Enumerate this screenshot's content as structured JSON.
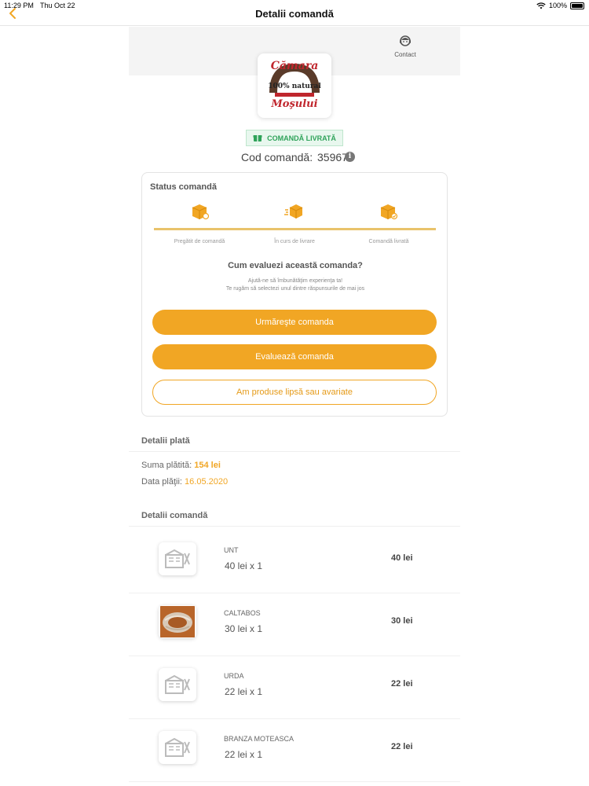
{
  "status_bar": {
    "time": "11:29 PM",
    "date": "Thu Oct 22",
    "battery": "100%"
  },
  "nav": {
    "title": "Detalii comandă"
  },
  "header": {
    "contact_label": "Contact",
    "logo_top": "Cămara",
    "logo_mid": "100% natural",
    "logo_bottom": "Moşului"
  },
  "order": {
    "badge": "COMANDĂ LIVRATĂ",
    "code_label": "Cod comandă:",
    "code": "35967",
    "info_glyph": "i"
  },
  "status": {
    "title": "Status comandă",
    "steps": [
      {
        "label": "Pregătit de comandă"
      },
      {
        "label": "În curs de livrare"
      },
      {
        "label": "Comandă livrată"
      }
    ],
    "progress": 1.0,
    "eval_title": "Cum evaluezi această comanda?",
    "eval_sub1": "Ajută-ne să îmbunătăţim experienţa ta!",
    "eval_sub2": "Te rugăm să selectezi unul dintre răspunsurile de mai jos",
    "btn_track": "Urmăreşte comanda",
    "btn_rate": "Evaluează comanda",
    "btn_missing": "Am produse lipsă sau avariate"
  },
  "payment": {
    "title": "Detalii plată",
    "sum_label": "Suma plătită:",
    "sum_value": "154 lei",
    "date_label": "Data plăţii:",
    "date_value": "16.05.2020"
  },
  "details": {
    "title": "Detalii comandă",
    "items": [
      {
        "name": "UNT",
        "qty": "40 lei x 1",
        "price": "40 lei",
        "image": "placeholder-logo"
      },
      {
        "name": "CALTABOS",
        "qty": "30 lei x 1",
        "price": "30 lei",
        "image": "sausage-photo"
      },
      {
        "name": "URDA",
        "qty": "22 lei x 1",
        "price": "22 lei",
        "image": "placeholder-logo"
      },
      {
        "name": "BRANZA MOTEASCA",
        "qty": "22 lei x 1",
        "price": "22 lei",
        "image": "placeholder-logo"
      }
    ]
  },
  "colors": {
    "accent": "#f1a624",
    "success": "#2fa35a"
  }
}
